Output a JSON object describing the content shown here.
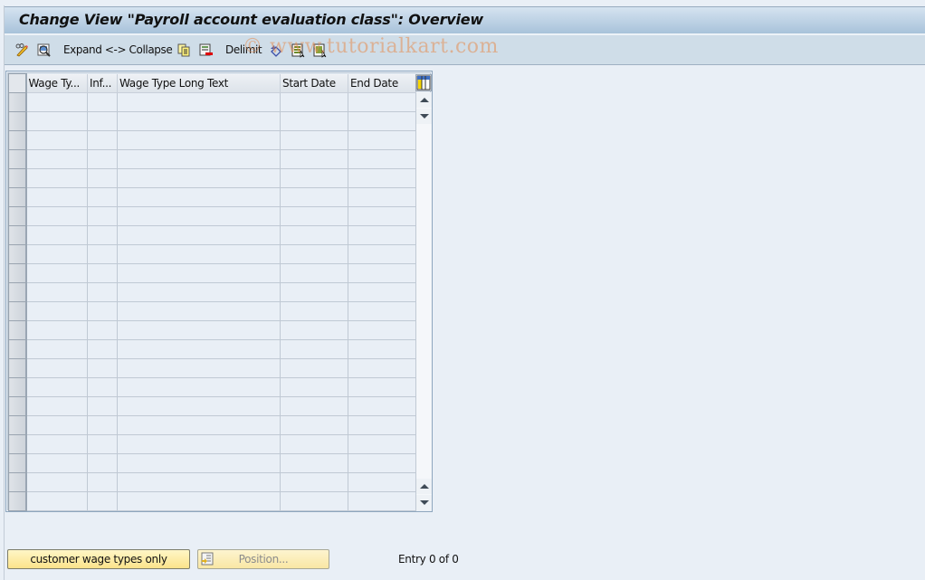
{
  "window": {
    "title": "Change View \"Payroll account evaluation class\": Overview"
  },
  "toolbar": {
    "items": [
      {
        "icon": "display-change-icon",
        "label": ""
      },
      {
        "icon": "details-icon",
        "label": ""
      },
      {
        "label": "Expand <-> Collapse"
      },
      {
        "icon": "copy-as-icon",
        "label": ""
      },
      {
        "icon": "delete-icon",
        "label": ""
      },
      {
        "label": "Delimit"
      },
      {
        "icon": "undo-change-icon",
        "label": ""
      },
      {
        "icon": "select-all-icon",
        "label": ""
      },
      {
        "icon": "select-block-icon",
        "label": ""
      }
    ],
    "expand_collapse_label": "Expand <-> Collapse",
    "delimit_label": "Delimit"
  },
  "watermark": "© www.tutorialkart.com",
  "table": {
    "columns": [
      {
        "key": "wage_type",
        "label": "Wage Ty..."
      },
      {
        "key": "infotype",
        "label": "Inf..."
      },
      {
        "key": "long_text",
        "label": "Wage Type Long Text"
      },
      {
        "key": "start_date",
        "label": "Start Date"
      },
      {
        "key": "end_date",
        "label": "End Date"
      }
    ],
    "rows": [],
    "visible_empty_rows": 22,
    "column_settings_icon": "table-settings-icon"
  },
  "footer": {
    "customer_button_label": "customer wage types only",
    "position_button_label": "Position...",
    "entry_text": "Entry 0 of 0"
  },
  "colors": {
    "title_gradient_top": "#d5e3f0",
    "title_gradient_bottom": "#a8c2da",
    "toolbar_bg": "#cfdde8",
    "page_bg": "#e9eff6",
    "button_yellow": "#fbe38a"
  }
}
